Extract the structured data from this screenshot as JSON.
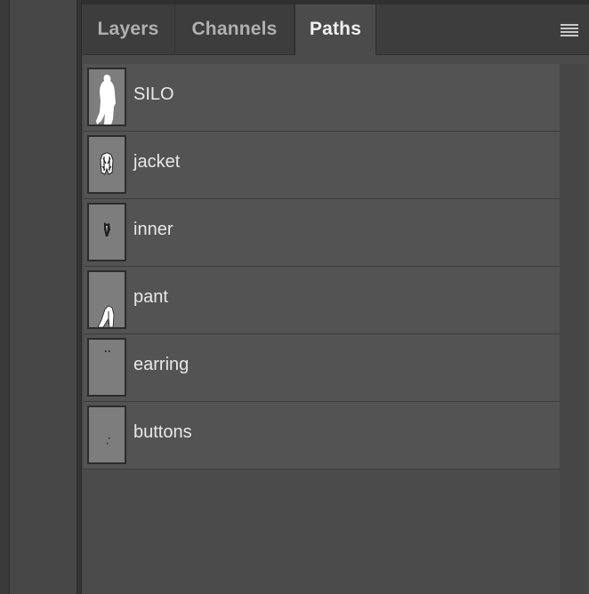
{
  "panel": {
    "tabs": [
      {
        "label": "Layers",
        "active": false
      },
      {
        "label": "Channels",
        "active": false
      },
      {
        "label": "Paths",
        "active": true
      }
    ],
    "menu_icon": "hamburger-menu-icon"
  },
  "paths": [
    {
      "name": "SILO",
      "thumbnail": "silhouette-full-figure-icon"
    },
    {
      "name": "jacket",
      "thumbnail": "jacket-shape-icon"
    },
    {
      "name": "inner",
      "thumbnail": "inner-shape-icon"
    },
    {
      "name": "pant",
      "thumbnail": "pant-shape-icon"
    },
    {
      "name": "earring",
      "thumbnail": "earring-shape-icon"
    },
    {
      "name": "buttons",
      "thumbnail": "buttons-shape-icon"
    }
  ],
  "colors": {
    "panel_bg": "#4b4b4b",
    "row_bg": "#535353",
    "thumb_bg": "#7d7d7d",
    "text": "#e8e8e8"
  }
}
